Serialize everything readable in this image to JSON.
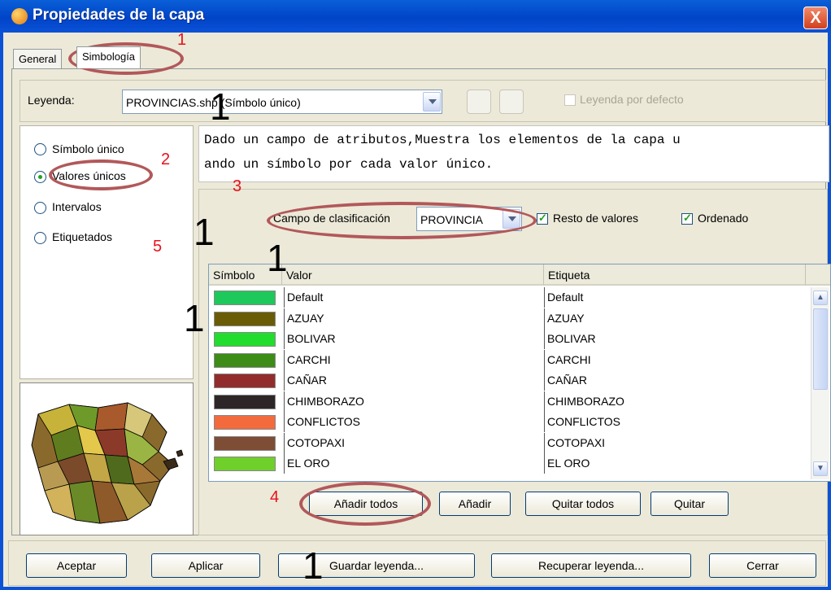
{
  "window": {
    "title": "Propiedades de la capa",
    "close_glyph": "X"
  },
  "tabs": [
    {
      "label": "General"
    },
    {
      "label": "Simbología"
    }
  ],
  "legend": {
    "label": "Leyenda:",
    "combo_value": "PROVINCIAS.shp (Símbolo único)",
    "default_checkbox_label": "Leyenda por defecto"
  },
  "methods": [
    {
      "label": "Símbolo único",
      "selected": false
    },
    {
      "label": "Valores únicos",
      "selected": true
    },
    {
      "label": "Intervalos",
      "selected": false
    },
    {
      "label": "Etiquetados",
      "selected": false
    }
  ],
  "description": {
    "line1": "Dado un campo de atributos,Muestra los elementos de la capa u",
    "line2": "ando un símbolo por cada valor único."
  },
  "classification": {
    "label": "Campo de clasificación",
    "value": "PROVINCIA",
    "resto_label": "Resto de valores",
    "resto_checked": true,
    "ordenado_label": "Ordenado",
    "ordenado_checked": true
  },
  "table": {
    "headers": [
      "Símbolo",
      "Valor",
      "Etiqueta"
    ],
    "rows": [
      {
        "color": "#1ec85a",
        "valor": "Default",
        "etiqueta": "Default"
      },
      {
        "color": "#6a5c06",
        "valor": "AZUAY",
        "etiqueta": "AZUAY"
      },
      {
        "color": "#22dd2e",
        "valor": "BOLIVAR",
        "etiqueta": "BOLIVAR"
      },
      {
        "color": "#3d8c17",
        "valor": "CARCHI",
        "etiqueta": "CARCHI"
      },
      {
        "color": "#922c2c",
        "valor": "CAÑAR",
        "etiqueta": "CAÑAR"
      },
      {
        "color": "#2d2628",
        "valor": "CHIMBORAZO",
        "etiqueta": "CHIMBORAZO"
      },
      {
        "color": "#f36a3d",
        "valor": "CONFLICTOS",
        "etiqueta": "CONFLICTOS"
      },
      {
        "color": "#7e4d35",
        "valor": "COTOPAXI",
        "etiqueta": "COTOPAXI"
      },
      {
        "color": "#6fcf2b",
        "valor": "EL ORO",
        "etiqueta": "EL ORO"
      }
    ]
  },
  "table_buttons": {
    "add_all": "Añadir todos",
    "add": "Añadir",
    "remove_all": "Quitar todos",
    "remove": "Quitar"
  },
  "footer": {
    "accept": "Aceptar",
    "apply": "Aplicar",
    "save_legend": "Guardar leyenda...",
    "load_legend": "Recuperar leyenda...",
    "close": "Cerrar"
  },
  "annotations": {
    "big": [
      "1",
      "1",
      "1",
      "1",
      "1"
    ],
    "red": [
      "1",
      "2",
      "3",
      "4",
      "5"
    ]
  },
  "colors": {
    "accent": "#0c52d6",
    "annotation_red": "#e8101a",
    "highlight_ellipse": "#b2585a"
  }
}
